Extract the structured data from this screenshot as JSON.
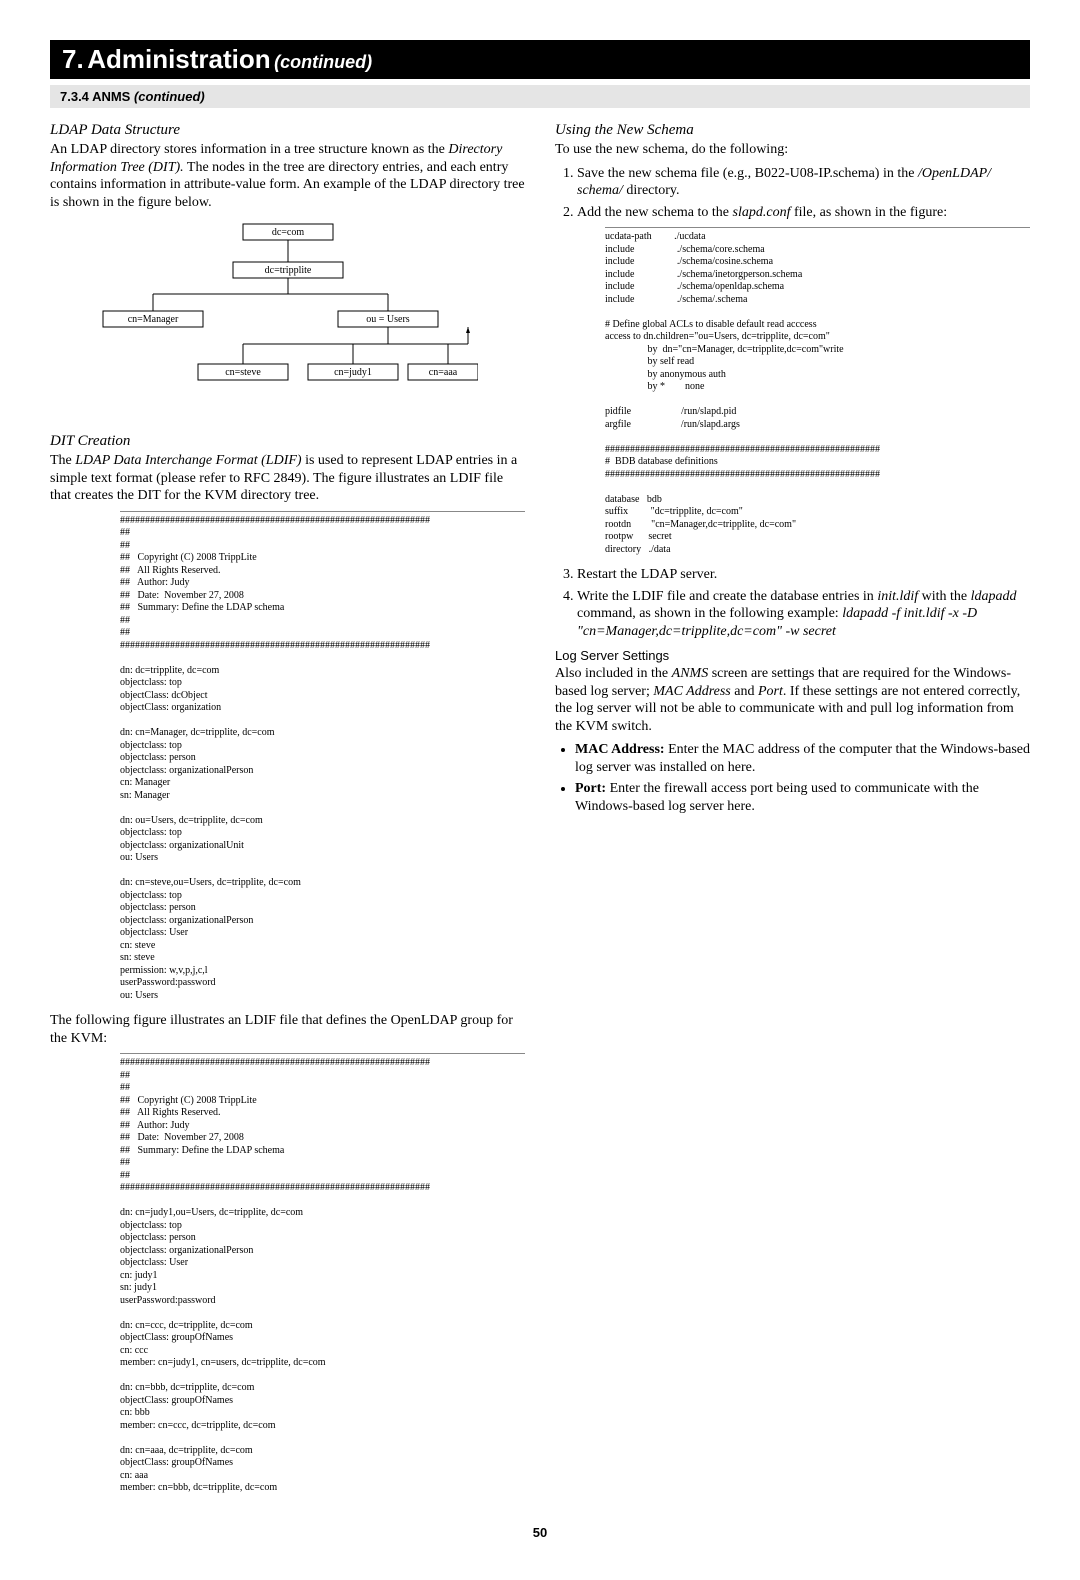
{
  "chapter": {
    "number": "7.",
    "title": "Administration",
    "cont": "(continued)"
  },
  "section": {
    "number": "7.3.4",
    "title": "ANMS",
    "cont": "(continued)"
  },
  "left": {
    "h1": "LDAP Data Structure",
    "p1": "An LDAP directory stores information in a tree structure known as the ",
    "p1_em": "Directory Information Tree (DIT).",
    "p1b": " The nodes in the tree are directory entries, and each entry contains information in attribute-value form. An example of the LDAP directory tree is shown in the figure below.",
    "diag": {
      "n1": "dc=com",
      "n2": "dc=tripplite",
      "n3": "cn=Manager",
      "n4": "ou = Users",
      "n5": "cn=steve",
      "n6": "cn=judy1",
      "n7": "cn=aaa"
    },
    "h2": "DIT Creation",
    "p2a": "The ",
    "p2a_em": "LDAP Data Interchange Format (LDIF)",
    "p2b": " is used to represent LDAP entries in a simple text format (please refer to RFC 2849). The figure illustrates an LDIF file that creates the DIT for the KVM directory tree.",
    "code1": "##############################################################\n##\n##\n##   Copyright (C) 2008 TrippLite\n##   All Rights Reserved.\n##   Author: Judy\n##   Date:  November 27, 2008\n##   Summary: Define the LDAP schema\n##\n##\n##############################################################\n\ndn: dc=tripplite, dc=com\nobjectclass: top\nobjectClass: dcObject\nobjectClass: organization\n\ndn: cn=Manager, dc=tripplite, dc=com\nobjectclass: top\nobjectclass: person\nobjectclass: organizationalPerson\ncn: Manager\nsn: Manager\n\ndn: ou=Users, dc=tripplite, dc=com\nobjectclass: top\nobjectclass: organizationalUnit\nou: Users\n\ndn: cn=steve,ou=Users, dc=tripplite, dc=com\nobjectclass: top\nobjectclass: person\nobjectclass: organizationalPerson\nobjectclass: User\ncn: steve\nsn: steve\npermission: w,v,p,j,c,l\nuserPassword:password\nou: Users",
    "p3": "The following figure illustrates an LDIF file that defines the OpenLDAP group for the KVM:",
    "code2": "##############################################################\n##\n##\n##   Copyright (C) 2008 TrippLite\n##   All Rights Reserved.\n##   Author: Judy\n##   Date:  November 27, 2008\n##   Summary: Define the LDAP schema\n##\n##\n##############################################################\n\ndn: cn=judy1,ou=Users, dc=tripplite, dc=com\nobjectclass: top\nobjectclass: person\nobjectclass: organizationalPerson\nobjectclass: User\ncn: judy1\nsn: judy1\nuserPassword:password\n\ndn: cn=ccc, dc=tripplite, dc=com\nobjectClass: groupOfNames\ncn: ccc\nmember: cn=judy1, cn=users, dc=tripplite, dc=com\n\ndn: cn=bbb, dc=tripplite, dc=com\nobjectClass: groupOfNames\ncn: bbb\nmember: cn=ccc, dc=tripplite, dc=com\n\ndn: cn=aaa, dc=tripplite, dc=com\nobjectClass: groupOfNames\ncn: aaa\nmember: cn=bbb, dc=tripplite, dc=com"
  },
  "right": {
    "h1": "Using the New Schema",
    "p1": "To use the new schema, do the following:",
    "li1a": "Save the new schema file (e.g., B022-U08-IP.schema) in the ",
    "li1_em": "/OpenLDAP/ schema/",
    "li1b": " directory.",
    "li2a": "Add the new schema to the ",
    "li2_em": "slapd.conf",
    "li2b": " file, as shown in the figure:",
    "code3": "ucdata-path         ./ucdata\ninclude                 ./schema/core.schema\ninclude                 ./schema/cosine.schema\ninclude                 ./schema/inetorgperson.schema\ninclude                 ./schema/openldap.schema\ninclude                 ./schema/.schema\n\n# Define global ACLs to disable default read acccess\naccess to dn.children=\"ou=Users, dc=tripplite, dc=com\"\n                 by  dn=\"cn=Manager, dc=tripplite,dc=com\"write\n                 by self read\n                 by anonymous auth\n                 by *        none\n\npidfile                    /run/slapd.pid\nargfile                    /run/slapd.args\n\n#######################################################\n#  BDB database definitions\n#######################################################\n\ndatabase   bdb\nsuffix         \"dc=tripplite, dc=com\"\nrootdn        \"cn=Manager,dc=tripplite, dc=com\"\nrootpw      secret\ndirectory   ./data",
    "li3": "Restart the LDAP server.",
    "li4a": "Write the LDIF file and create the database entries in ",
    "li4_em1": "init.ldif",
    "li4b": " with the ",
    "li4_em2": "ldapadd",
    "li4c": " command, as shown in the following example: ",
    "li4_em3": "ldapadd -f init.ldif -x -D \"cn=Manager,dc=tripplite,dc=com\" -w secret",
    "h2": "Log Server Settings",
    "p2a": "Also included in the ",
    "p2_em1": "ANMS",
    "p2b": " screen are settings that are required for the Windows-based log server; ",
    "p2_em2": "MAC Address",
    "p2c": " and ",
    "p2_em3": "Port",
    "p2d": ". If these settings are not entered correctly, the log server will not be able to communicate with and pull log information from the KVM switch.",
    "b1_b": "MAC Address:",
    "b1_t": " Enter the MAC address of the computer that the Windows-based log server was installed on here.",
    "b2_b": "Port:",
    "b2_t": " Enter the firewall access port being used to communicate with the Windows-based log server here."
  },
  "pagenum": "50"
}
